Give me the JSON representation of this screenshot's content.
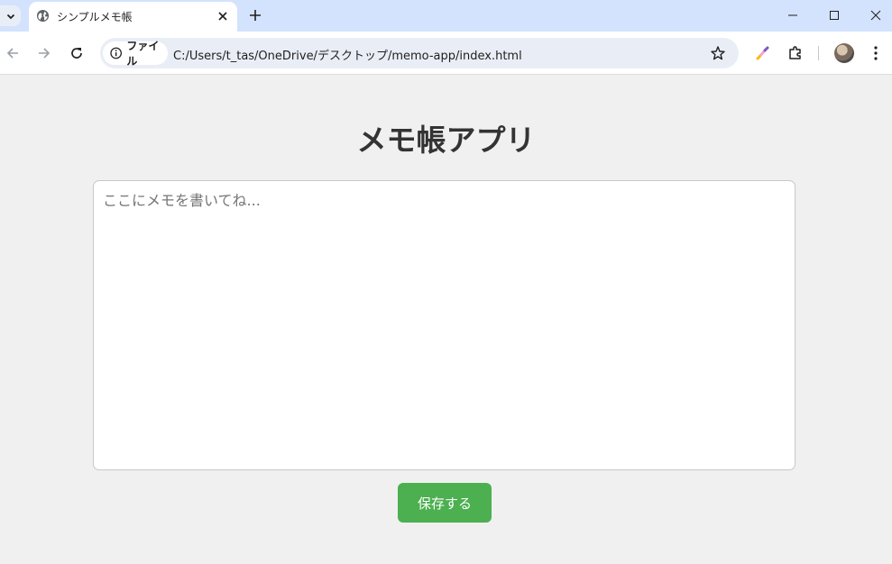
{
  "browser": {
    "tab": {
      "title": "シンプルメモ帳"
    },
    "address": {
      "chip_label": "ファイル",
      "url": "C:/Users/t_tas/OneDrive/デスクトップ/memo-app/index.html"
    },
    "icons": {
      "tab_search": "chevron-down-icon",
      "favicon": "globe-icon",
      "tab_close": "close-icon",
      "new_tab": "plus-icon",
      "minimize": "minimize-icon",
      "maximize": "maximize-icon",
      "close_window": "close-icon",
      "back": "arrow-left-icon",
      "forward": "arrow-right-icon",
      "reload": "reload-icon",
      "info": "info-icon",
      "bookmark": "star-icon",
      "pen": "pen-icon",
      "extensions": "puzzle-icon",
      "menu": "more-vertical-icon"
    }
  },
  "app": {
    "title": "メモ帳アプリ",
    "memo": {
      "placeholder": "ここにメモを書いてね...",
      "value": ""
    },
    "save_label": "保存する"
  },
  "colors": {
    "accent": "#4caf50",
    "page_background": "#f0f0f0",
    "title_text": "#333333",
    "tabbar": "#d3e3fd"
  }
}
